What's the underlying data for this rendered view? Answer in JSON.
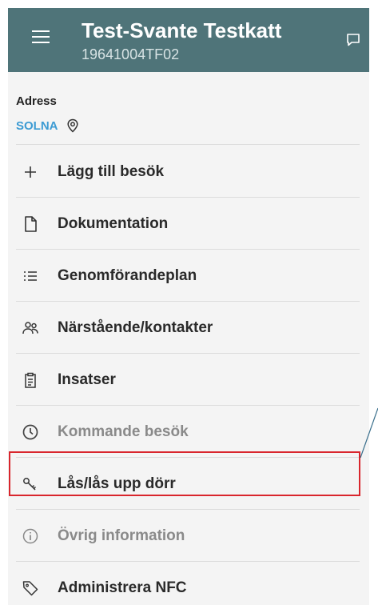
{
  "header": {
    "title": "Test-Svante Testkatt",
    "subtitle": "19641004TF02"
  },
  "address": {
    "label": "Adress",
    "city": "SOLNA"
  },
  "menu": {
    "items": [
      {
        "id": "add-visit",
        "label": "Lägg till besök",
        "icon": "plus-icon",
        "disabled": false
      },
      {
        "id": "documentation",
        "label": "Dokumentation",
        "icon": "document-icon",
        "disabled": false
      },
      {
        "id": "implementation-plan",
        "label": "Genomförandeplan",
        "icon": "list-icon",
        "disabled": false
      },
      {
        "id": "contacts",
        "label": "Närstående/kontakter",
        "icon": "people-icon",
        "disabled": false
      },
      {
        "id": "interventions",
        "label": "Insatser",
        "icon": "clipboard-icon",
        "disabled": false
      },
      {
        "id": "upcoming-visits",
        "label": "Kommande besök",
        "icon": "clock-icon",
        "disabled": true
      },
      {
        "id": "lock-door",
        "label": "Lås/lås upp dörr",
        "icon": "key-icon",
        "disabled": false,
        "highlighted": true
      },
      {
        "id": "other-info",
        "label": "Övrig information",
        "icon": "info-icon",
        "disabled": true
      },
      {
        "id": "nfc",
        "label": "Administrera NFC",
        "icon": "tag-icon",
        "disabled": false
      }
    ]
  },
  "colors": {
    "app_bar": "#4f7479",
    "link": "#3c9bd3",
    "highlight": "#d9262d",
    "callout": "#3a6f8c"
  }
}
